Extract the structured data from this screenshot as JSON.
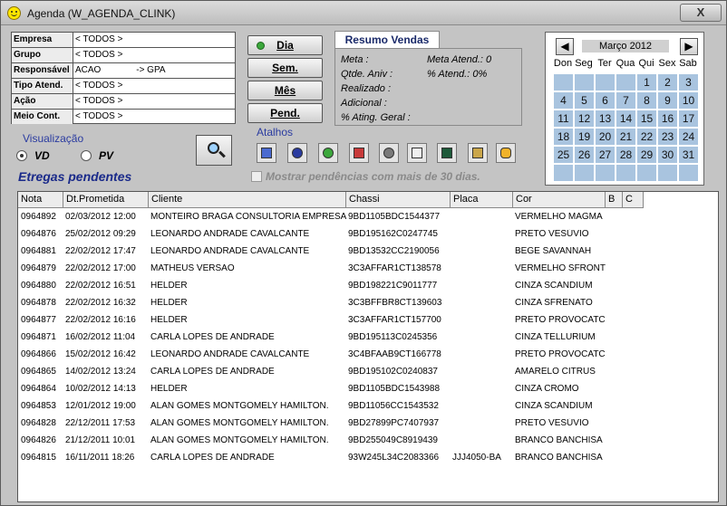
{
  "window": {
    "title": "Agenda (W_AGENDA_CLINK)",
    "close_label": "X"
  },
  "filters": [
    {
      "label": "Empresa",
      "value": "< TODOS >"
    },
    {
      "label": "Grupo",
      "value": "< TODOS >"
    },
    {
      "label": "Responsável",
      "value": "ACAO              -> GPA"
    },
    {
      "label": "Tipo Atend.",
      "value": "< TODOS >"
    },
    {
      "label": "Ação",
      "value": "< TODOS >"
    },
    {
      "label": "Meio Cont.",
      "value": "< TODOS >"
    }
  ],
  "period_buttons": {
    "dia": "Dia",
    "sem": "Sem.",
    "mes": "Mês",
    "pend": "Pend."
  },
  "resumo": {
    "tab": "Resumo Vendas",
    "meta": "Meta :",
    "meta_atend": "Meta Atend.: 0",
    "qtde_aniv": "Qtde. Aniv :",
    "pct_atend": "% Atend.: 0%",
    "realizado": "Realizado :",
    "adicional": "Adicional :",
    "pct_ating": "% Ating. Geral :"
  },
  "atalhos": {
    "title": "Atalhos",
    "icons": [
      "calendar-icon",
      "person-icon",
      "globe-icon",
      "car-icon",
      "tools-icon",
      "checklist-icon",
      "screen-icon",
      "chip-icon",
      "bag-icon"
    ]
  },
  "calendar": {
    "month": "Março 2012",
    "prev": "◀",
    "next": "▶",
    "weekdays": [
      "Don",
      "Seg",
      "Ter",
      "Qua",
      "Qui",
      "Sex",
      "Sab"
    ],
    "weeks": [
      [
        "",
        "",
        "",
        "",
        "1",
        "2",
        "3"
      ],
      [
        "4",
        "5",
        "6",
        "7",
        "8",
        "9",
        "10"
      ],
      [
        "11",
        "12",
        "13",
        "14",
        "15",
        "16",
        "17"
      ],
      [
        "18",
        "19",
        "20",
        "21",
        "22",
        "23",
        "24"
      ],
      [
        "25",
        "26",
        "27",
        "28",
        "29",
        "30",
        "31"
      ],
      [
        "",
        "",
        "",
        "",
        "",
        "",
        ""
      ]
    ]
  },
  "visualizacao": {
    "title": "Visualização",
    "vd": "VD",
    "pv": "PV",
    "selected": "VD"
  },
  "section_title": "Etregas pendentes",
  "checkbox_label": "Mostrar pendências com mais de 30 dias.",
  "table": {
    "headers": [
      "Nota",
      "Dt.Prometida",
      "Cliente",
      "Chassi",
      "Placa",
      "Cor",
      "B",
      "C"
    ],
    "rows": [
      [
        "0964892",
        "02/03/2012  12:00",
        "MONTEIRO BRAGA CONSULTORIA EMPRESA",
        "9BD1105BDC1544377",
        "",
        "VERMELHO MAGMA"
      ],
      [
        "0964876",
        "25/02/2012  09:29",
        "LEONARDO ANDRADE CAVALCANTE",
        "9BD195162C0247745",
        "",
        "PRETO VESÚVIO"
      ],
      [
        "0964881",
        "22/02/2012  17:47",
        "LEONARDO ANDRADE CAVALCANTE",
        "9BD13532CC2190056",
        "",
        "BEGE SAVANNAH"
      ],
      [
        "0964879",
        "22/02/2012  17:00",
        "MATHEUS VERSAO",
        "3C3AFFAR1CT138578",
        "",
        "VERMELHO SFRONT"
      ],
      [
        "0964880",
        "22/02/2012  16:51",
        "HELDER",
        "9BD198221C9011777",
        "",
        "CINZA SCANDIUM"
      ],
      [
        "0964878",
        "22/02/2012  16:32",
        "HELDER",
        "3C3BFFBR8CT139603",
        "",
        "CINZA SFRENATO"
      ],
      [
        "0964877",
        "22/02/2012  16:16",
        "HELDER",
        "3C3AFFAR1CT157700",
        "",
        "PRETO PROVOCATC"
      ],
      [
        "0964871",
        "16/02/2012  11:04",
        "CARLA  LOPES DE ANDRADE",
        "9BD195113C0245356",
        "",
        "CINZA TELLURIUM"
      ],
      [
        "0964866",
        "15/02/2012  16:42",
        "LEONARDO ANDRADE CAVALCANTE",
        "3C4BFAAB9CT166778",
        "",
        "PRETO PROVOCATC"
      ],
      [
        "0964865",
        "14/02/2012  13:24",
        "CARLA  LOPES DE ANDRADE",
        "9BD195102C0240837",
        "",
        "AMARELO CITRUS"
      ],
      [
        "0964864",
        "10/02/2012  14:13",
        "HELDER",
        "9BD1105BDC1543988",
        "",
        "CINZA CROMO"
      ],
      [
        "0964853",
        "12/01/2012  19:00",
        "ALAN GOMES MONTGOMELY HAMILTON.",
        "9BD11056CC1543532",
        "",
        "CINZA SCANDIUM"
      ],
      [
        "0964828",
        "22/12/2011  17:53",
        "ALAN GOMES MONTGOMELY HAMILTON.",
        "9BD27899PC7407937",
        "",
        "PRETO VESÚVIO"
      ],
      [
        "0964826",
        "21/12/2011  10:01",
        "ALAN GOMES MONTGOMELY HAMILTON.",
        "9BD255049C8919439",
        "",
        "BRANCO BANCHISA"
      ],
      [
        "0964815",
        "16/11/2011  18:26",
        "CARLA  LOPES DE ANDRADE",
        "93W245L34C2083366",
        "JJJ4050-BA",
        "BRANCO BANCHISA"
      ]
    ]
  },
  "colors": {
    "calendar_day": "#a9c4df",
    "accent_blue": "#2a3ba0"
  }
}
